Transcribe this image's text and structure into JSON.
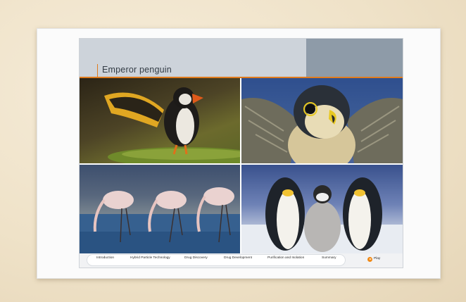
{
  "slide": {
    "title": "Emperor penguin"
  },
  "photos": [
    {
      "name": "puffin"
    },
    {
      "name": "peregrine falcon"
    },
    {
      "name": "flamingos"
    },
    {
      "name": "emperor penguins"
    }
  ],
  "nav": {
    "items": [
      "Introduction",
      "Hybrid Particle Technology",
      "Drug Discovery",
      "Drug Development",
      "Purification and Isolation",
      "Summary"
    ],
    "play_label": "Play"
  },
  "colors": {
    "accent": "#e07b1d",
    "header_bg": "#cdd3da",
    "header_block": "#8e9ba8",
    "play": "#f08a17"
  }
}
